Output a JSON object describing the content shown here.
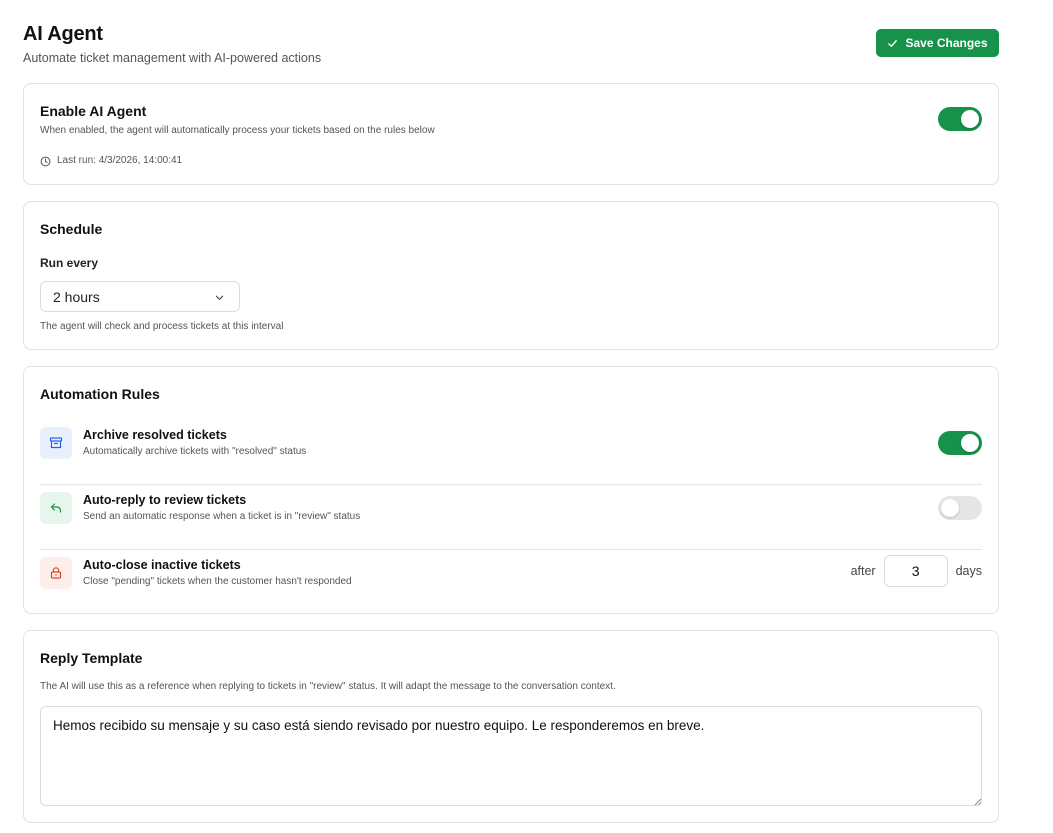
{
  "header": {
    "title": "AI Agent",
    "subtitle": "Automate ticket management with AI-powered actions",
    "save_label": "Save Changes"
  },
  "enable": {
    "title": "Enable AI Agent",
    "description": "When enabled, the agent will automatically process your tickets based on the rules below",
    "enabled": true,
    "last_run": "Last run: 4/3/2026, 14:00:41"
  },
  "schedule": {
    "title": "Schedule",
    "run_label": "Run every",
    "selected": "2 hours",
    "hint": "The agent will check and process tickets at this interval"
  },
  "rules": {
    "title": "Automation Rules",
    "items": [
      {
        "title": "Archive resolved tickets",
        "description": "Automatically archive tickets with \"resolved\" status",
        "icon": "archive-icon",
        "enabled": true
      },
      {
        "title": "Auto-reply to review tickets",
        "description": "Send an automatic response when a ticket is in \"review\" status",
        "icon": "reply-icon",
        "enabled": false
      },
      {
        "title": "Auto-close inactive tickets",
        "description": "Close \"pending\" tickets when the customer hasn't responded",
        "icon": "lock-icon",
        "after_label": "after",
        "days_value": "3",
        "days_label": "days"
      }
    ]
  },
  "template": {
    "title": "Reply Template",
    "hint": "The AI will use this as a reference when replying to tickets in \"review\" status. It will adapt the message to the conversation context.",
    "text": "Hemos recibido su mensaje y su caso está siendo revisado por nuestro equipo. Le responderemos en breve."
  },
  "colors": {
    "accent": "#16924a",
    "archive_bg": "#e8f0fd",
    "reply_bg": "#e6f6ec",
    "lock_bg": "#fdeee9"
  }
}
